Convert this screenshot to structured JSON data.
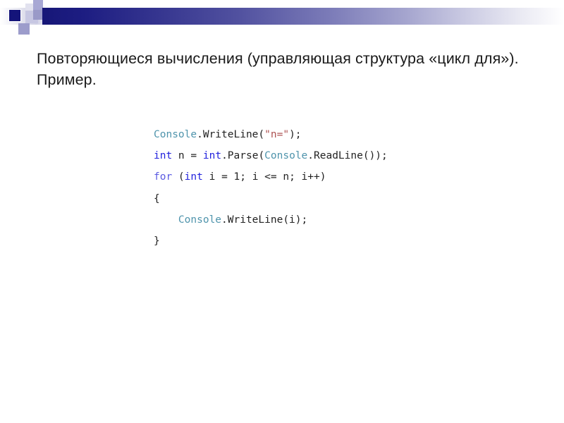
{
  "slide": {
    "title": "Повторяющиеся вычисления (управляющая структура «цикл для»). Пример.",
    "background_color": "#ffffff"
  },
  "header": {
    "banner_gradient_from": "#171778",
    "banner_gradient_to": "#ffffff",
    "accent_navy": "#14147a",
    "accent_periwinkle": "#9a9ac8",
    "accent_lavender": "#c7c7e2"
  },
  "code": {
    "language": "C#",
    "colors": {
      "type": "#4f94ac",
      "keyword": "#2222dd",
      "control": "#5b5be2",
      "string": "#ad5252",
      "plain": "#222222"
    },
    "lines": [
      {
        "index": 1,
        "text": "Console.WriteLine(\"n=\");",
        "tokens": [
          {
            "t": "Console",
            "k": "type"
          },
          {
            "t": ".WriteLine(",
            "k": "plain"
          },
          {
            "t": "\"n=\"",
            "k": "string"
          },
          {
            "t": ");",
            "k": "plain"
          }
        ]
      },
      {
        "index": 2,
        "text": "int n = int.Parse(Console.ReadLine());",
        "tokens": [
          {
            "t": "int",
            "k": "keyword"
          },
          {
            "t": " n = ",
            "k": "plain"
          },
          {
            "t": "int",
            "k": "keyword"
          },
          {
            "t": ".Parse(",
            "k": "plain"
          },
          {
            "t": "Console",
            "k": "type"
          },
          {
            "t": ".ReadLine());",
            "k": "plain"
          }
        ]
      },
      {
        "index": 3,
        "text": "for (int i = 1; i <= n; i++)",
        "tokens": [
          {
            "t": "for",
            "k": "control"
          },
          {
            "t": " (",
            "k": "plain"
          },
          {
            "t": "int",
            "k": "keyword"
          },
          {
            "t": " i = 1; i <= n; i++)",
            "k": "plain"
          }
        ]
      },
      {
        "index": 4,
        "text": "{",
        "tokens": [
          {
            "t": "{",
            "k": "plain"
          }
        ]
      },
      {
        "index": 5,
        "text": "    Console.WriteLine(i);",
        "tokens": [
          {
            "t": "    ",
            "k": "plain"
          },
          {
            "t": "Console",
            "k": "type"
          },
          {
            "t": ".WriteLine(i);",
            "k": "plain"
          }
        ]
      },
      {
        "index": 6,
        "text": "}",
        "tokens": [
          {
            "t": "}",
            "k": "plain"
          }
        ]
      }
    ]
  }
}
